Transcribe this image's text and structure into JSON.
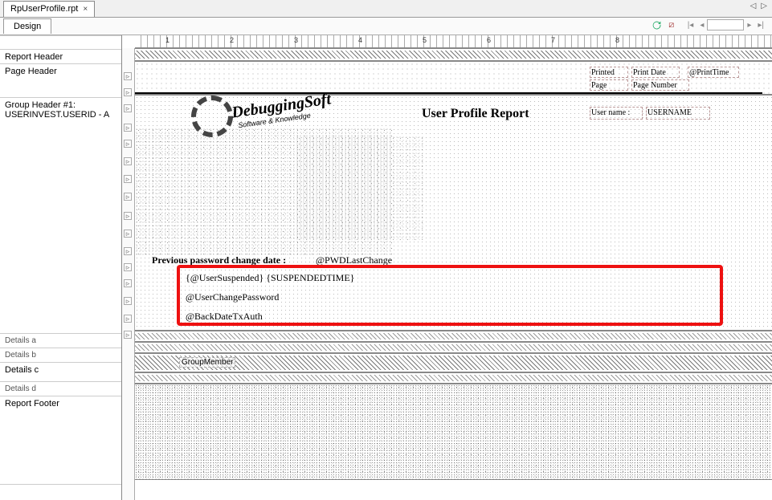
{
  "tab": {
    "filename": "RpUserProfile.rpt"
  },
  "mode_tab": "Design",
  "sidebar": {
    "report_header": "Report Header",
    "page_header": "Page Header",
    "group_header": "Group Header #1:\nUSERINVEST.USERID - A",
    "details_a": "Details a",
    "details_b": "Details b",
    "details_c": "Details c",
    "details_d": "Details d",
    "report_footer": "Report Footer"
  },
  "ruler_numbers": [
    "1",
    "2",
    "3",
    "4",
    "5",
    "6",
    "7",
    "8"
  ],
  "page_header_fields": {
    "printed_lbl": "Printed",
    "print_date": "Print Date",
    "print_time": "@PrintTime",
    "page_lbl": "Page",
    "page_number": "Page Number",
    "line1": true
  },
  "group_header_fields": {
    "logo_main": "DebuggingSoft",
    "logo_sub": "Software & Knowledge",
    "title": "User Profile Report",
    "username_lbl": "User name :",
    "username_val": "USERNAME",
    "prev_pwd_lbl": "Previous password change date   :",
    "prev_pwd_val": "@PWDLastChange",
    "line_suspended": "{@UserSuspended} {SUSPENDEDTIME}",
    "line_changepwd": "@UserChangePassword",
    "line_backdate": "@BackDateTxAuth"
  },
  "details_c_field": "GroupMember"
}
